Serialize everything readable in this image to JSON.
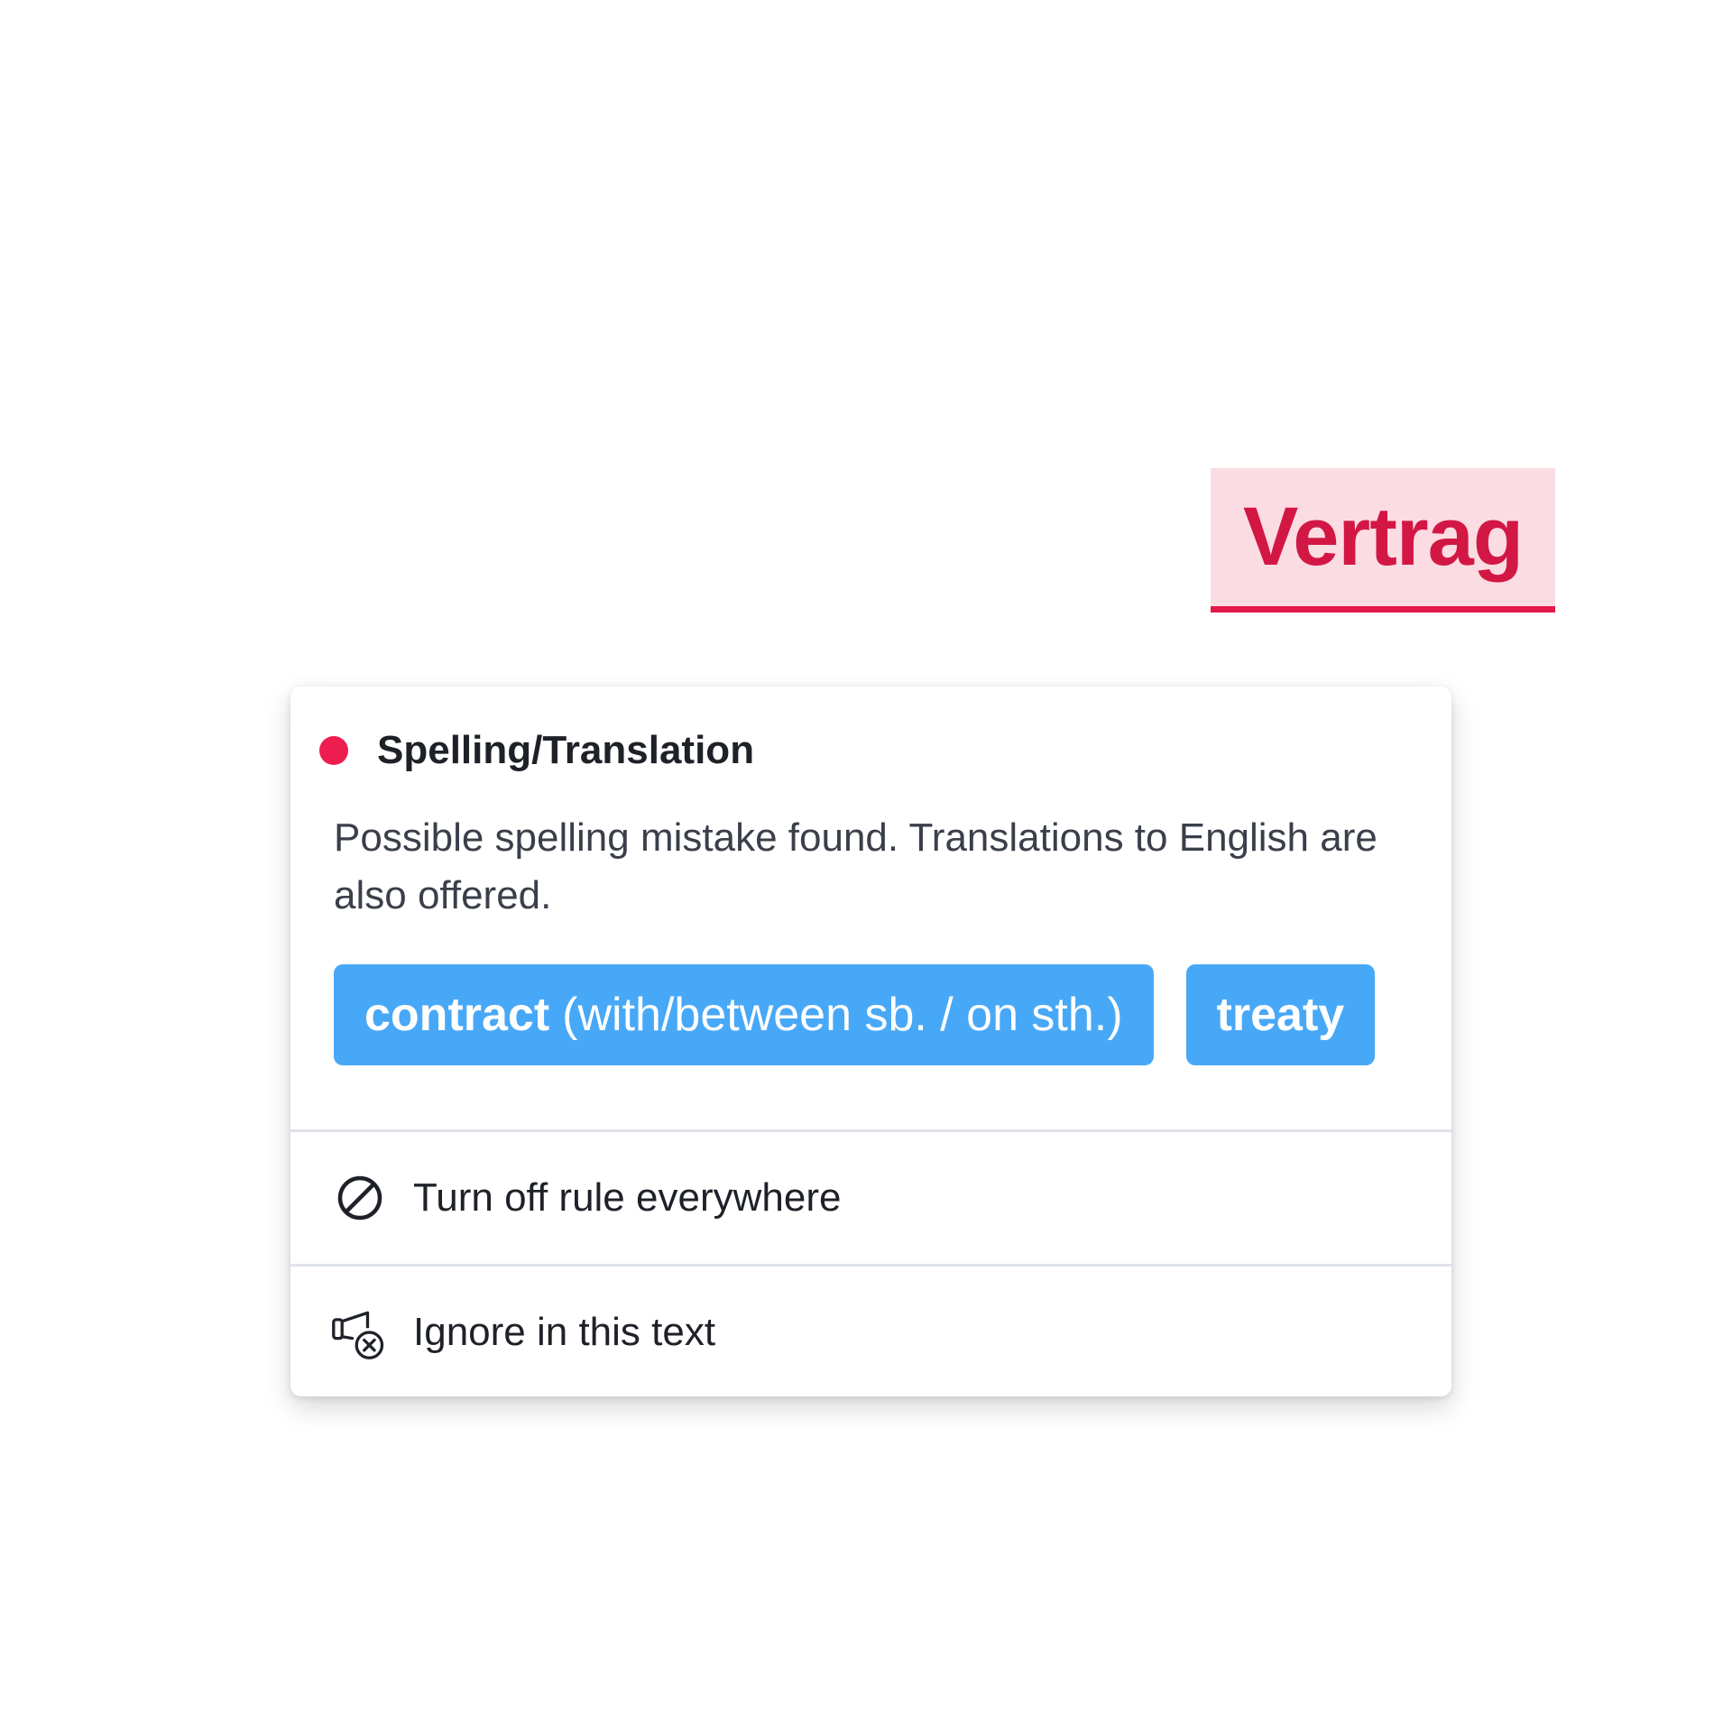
{
  "flagged_word": {
    "text": "Vertrag"
  },
  "popup": {
    "rule_title": "Spelling/Translation",
    "rule_color": "#ee1d4f",
    "message": "Possible spelling mistake found. Translations to English are also offered.",
    "suggestions": [
      {
        "main": "contract",
        "detail": "(with/between sb. / on sth.)"
      },
      {
        "main": "treaty",
        "detail": ""
      }
    ],
    "actions": [
      {
        "label": "Turn off rule everywhere",
        "icon": "prohibit-icon"
      },
      {
        "label": "Ignore in this text",
        "icon": "megaphone-ignore-icon"
      }
    ]
  },
  "colors": {
    "accent_blue": "#48a8f8",
    "error_red": "#e3174a",
    "highlight_bg": "#fbdce3"
  }
}
